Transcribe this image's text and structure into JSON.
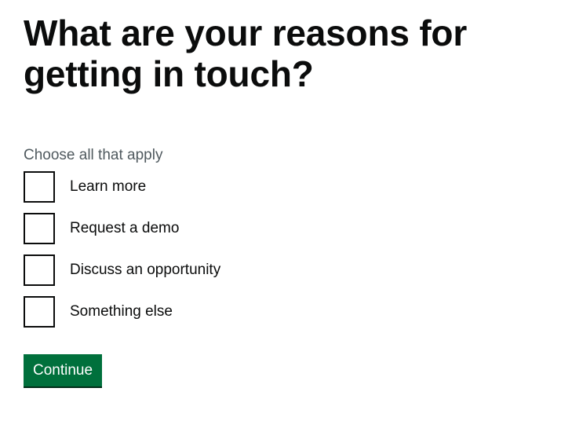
{
  "page": {
    "heading": "What are your reasons for getting in touch?"
  },
  "form": {
    "hint": "Choose all that apply",
    "options": [
      {
        "label": "Learn more",
        "checked": false
      },
      {
        "label": "Request a demo",
        "checked": false
      },
      {
        "label": "Discuss an opportunity",
        "checked": false
      },
      {
        "label": "Something else",
        "checked": false
      }
    ],
    "continue_label": "Continue"
  },
  "colors": {
    "text": "#0b0c0c",
    "hint": "#505a5f",
    "button": "#00703c",
    "button_shadow": "#002d18"
  }
}
